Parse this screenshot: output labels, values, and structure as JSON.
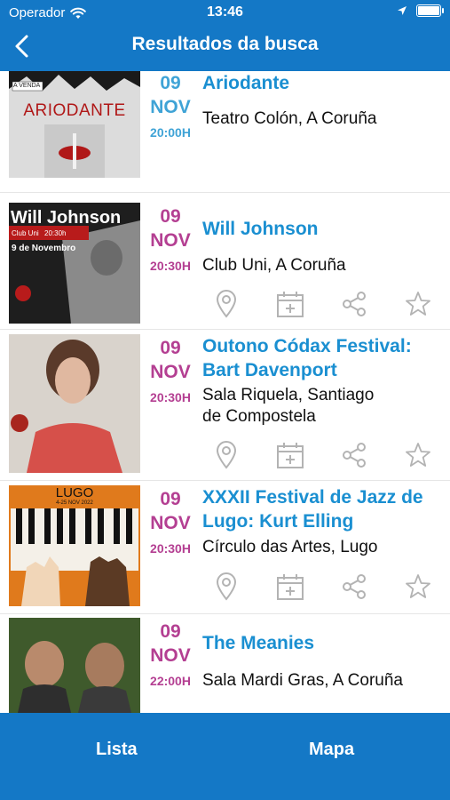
{
  "status": {
    "carrier": "Operador",
    "time": "13:46"
  },
  "header": {
    "title": "Resultados da busca"
  },
  "events": [
    {
      "day": "09",
      "month": "NOV",
      "time": "20:00H",
      "title_lines": [
        "Ariodante"
      ],
      "venue_lines": [
        "Teatro Colón, A Coruña"
      ],
      "date_color": "#3fa3d6",
      "poster_text": "ARIODANTE",
      "poster_tag": "A VENDA"
    },
    {
      "day": "09",
      "month": "NOV",
      "time": "20:30H",
      "title_lines": [
        "Will Johnson"
      ],
      "venue_lines": [
        "Club Uni, A Coruña"
      ],
      "date_color": "#b43f92",
      "poster_text": "Will Johnson",
      "poster_sub": "Club Uni",
      "poster_time": "20:30h",
      "poster_date": "9 de Novembro"
    },
    {
      "day": "09",
      "month": "NOV",
      "time": "20:30H",
      "title_lines": [
        "Outono Códax Festival:",
        "Bart Davenport"
      ],
      "venue_lines": [
        "Sala Riquela, Santiago",
        "de Compostela"
      ],
      "date_color": "#b43f92"
    },
    {
      "day": "09",
      "month": "NOV",
      "time": "20:30H",
      "title_lines": [
        "XXXII Festival de Jazz de",
        "Lugo: Kurt Elling"
      ],
      "venue_lines": [
        "Círculo das Artes, Lugo"
      ],
      "date_color": "#b43f92",
      "poster_text": "LUGO",
      "poster_sub": "4-25 NOV 2022"
    },
    {
      "day": "09",
      "month": "NOV",
      "time": "22:00H",
      "title_lines": [
        "The Meanies"
      ],
      "venue_lines": [
        "Sala Mardi Gras, A Coruña"
      ],
      "date_color": "#b43f92"
    }
  ],
  "icons": {
    "location": "map-pin-icon",
    "calendar": "calendar-add-icon",
    "share": "share-icon",
    "favorite": "star-icon"
  },
  "tabs": {
    "list": "Lista",
    "map": "Mapa"
  },
  "colors": {
    "primary": "#1478c6",
    "title_blue": "#1a8fd1",
    "date_magenta": "#b43f92",
    "date_blue": "#3fa3d6",
    "icon_gray": "#b3b3b3"
  }
}
